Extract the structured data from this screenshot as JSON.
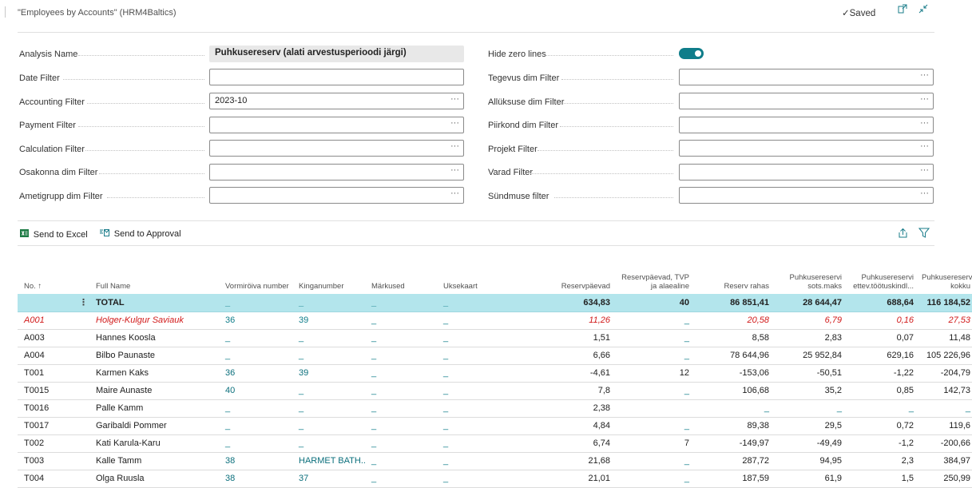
{
  "header": {
    "title": "\"Employees by Accounts\" (HRM4Baltics)",
    "saved": "✓Saved"
  },
  "filters": {
    "left": [
      {
        "label": "Analysis Name",
        "value": "Puhkusereserv (alati arvestusperioodi järgi)"
      },
      {
        "label": "Date Filter",
        "value": ""
      },
      {
        "label": "Accounting Filter",
        "value": "2023-10"
      },
      {
        "label": "Payment Filter",
        "value": ""
      },
      {
        "label": "Calculation Filter",
        "value": ""
      },
      {
        "label": "Osakonna dim Filter",
        "value": ""
      },
      {
        "label": "Ametigrupp dim Filter",
        "value": ""
      }
    ],
    "right": [
      {
        "label": "Hide zero lines",
        "value": "on"
      },
      {
        "label": "Tegevus dim Filter",
        "value": ""
      },
      {
        "label": "Allüksuse dim Filter",
        "value": ""
      },
      {
        "label": "Piirkond dim Filter",
        "value": ""
      },
      {
        "label": "Projekt Filter",
        "value": ""
      },
      {
        "label": "Varad Filter",
        "value": ""
      },
      {
        "label": "Sündmuse filter",
        "value": ""
      }
    ],
    "ellipsis": "···"
  },
  "actions": {
    "send_to_excel": "Send to Excel",
    "send_to_approval": "Send to Approval"
  },
  "table": {
    "columns": [
      "No. ↑",
      "Full Name",
      "Vormiröiva number",
      "Kinganumber",
      "Märkused",
      "Uksekaart",
      "Reservpäevad",
      "Reservpäevad, TVP ja alaealine",
      "Reserv rahas",
      "Puhkusereservi sots.maks",
      "Puhkusereservi ettev.töötuskindl...",
      "Puhkusereserv kokku"
    ],
    "total": {
      "no": "",
      "name": "TOTAL",
      "c3": "_",
      "c4": "_",
      "c5": "_",
      "c6": "_",
      "c7": "634,83",
      "c8": "40",
      "c9": "86 851,41",
      "c10": "28 644,47",
      "c11": "688,64",
      "c12": "116 184,52"
    },
    "rows": [
      {
        "no": "A001",
        "name": "Holger-Kulgur Saviauk",
        "c3": "36",
        "c4": "39",
        "c5": "_",
        "c6": "_",
        "c7": "11,26",
        "c8": "_",
        "c9": "20,58",
        "c10": "6,79",
        "c11": "0,16",
        "c12": "27,53"
      },
      {
        "no": "A003",
        "name": "Hannes Koosla",
        "c3": "_",
        "c4": "_",
        "c5": "_",
        "c6": "_",
        "c7": "1,51",
        "c8": "_",
        "c9": "8,58",
        "c10": "2,83",
        "c11": "0,07",
        "c12": "11,48"
      },
      {
        "no": "A004",
        "name": "Bilbo Paunaste",
        "c3": "_",
        "c4": "_",
        "c5": "_",
        "c6": "_",
        "c7": "6,66",
        "c8": "_",
        "c9": "78 644,96",
        "c10": "25 952,84",
        "c11": "629,16",
        "c12": "105 226,96"
      },
      {
        "no": "T001",
        "name": "Karmen Kaks",
        "c3": "36",
        "c4": "39",
        "c5": "_",
        "c6": "_",
        "c7": "-4,61",
        "c8": "12",
        "c9": "-153,06",
        "c10": "-50,51",
        "c11": "-1,22",
        "c12": "-204,79"
      },
      {
        "no": "T0015",
        "name": "Maire Aunaste",
        "c3": "40",
        "c4": "_",
        "c5": "_",
        "c6": "_",
        "c7": "7,8",
        "c8": "_",
        "c9": "106,68",
        "c10": "35,2",
        "c11": "0,85",
        "c12": "142,73"
      },
      {
        "no": "T0016",
        "name": "Palle Kamm",
        "c3": "_",
        "c4": "_",
        "c5": "_",
        "c6": "_",
        "c7": "2,38",
        "c8": "",
        "c9": "_",
        "c10": "_",
        "c11": "_",
        "c12": "_"
      },
      {
        "no": "T0017",
        "name": "Garibaldi Pommer",
        "c3": "_",
        "c4": "_",
        "c5": "_",
        "c6": "_",
        "c7": "4,84",
        "c8": "_",
        "c9": "89,38",
        "c10": "29,5",
        "c11": "0,72",
        "c12": "119,6"
      },
      {
        "no": "T002",
        "name": "Kati Karula-Karu",
        "c3": "_",
        "c4": "_",
        "c5": "_",
        "c6": "_",
        "c7": "6,74",
        "c8": "7",
        "c9": "-149,97",
        "c10": "-49,49",
        "c11": "-1,2",
        "c12": "-200,66"
      },
      {
        "no": "T003",
        "name": "Kalle Tamm",
        "c3": "38",
        "c4": "HARMET BATH...",
        "c5": "_",
        "c6": "_",
        "c7": "21,68",
        "c8": "_",
        "c9": "287,72",
        "c10": "94,95",
        "c11": "2,3",
        "c12": "384,97"
      },
      {
        "no": "T004",
        "name": "Olga Ruusla",
        "c3": "38",
        "c4": "37",
        "c5": "_",
        "c6": "_",
        "c7": "21,01",
        "c8": "_",
        "c9": "187,59",
        "c10": "61,9",
        "c11": "1,5",
        "c12": "250,99"
      }
    ]
  }
}
